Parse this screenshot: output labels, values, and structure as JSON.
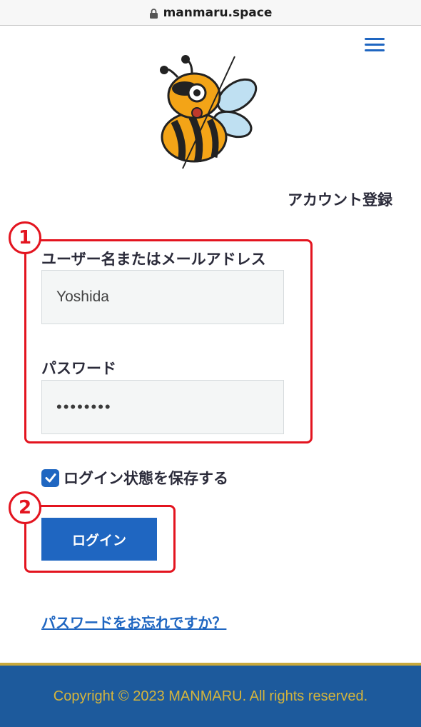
{
  "browser": {
    "url": "manmaru.space"
  },
  "header": {
    "menu_icon": "hamburger-icon"
  },
  "logo": {
    "icon": "bee-mascot-logo"
  },
  "nav": {
    "register_link": "アカウント登録"
  },
  "form": {
    "username_label": "ユーザー名またはメールアドレス",
    "username_value": "Yoshida",
    "password_label": "パスワード",
    "password_value": "••••••••",
    "remember_label": "ログイン状態を保存する",
    "remember_checked": true,
    "login_button": "ログイン",
    "forgot_link": "パスワードをお忘れですか？"
  },
  "annotations": {
    "step1": "1",
    "step2": "2",
    "color": "#e3141f"
  },
  "footer": {
    "copyright": "Copyright © 2023 MANMARU. All rights reserved."
  },
  "colors": {
    "accent": "#1f66c1",
    "footer_bg": "#1d5a9c",
    "footer_text": "#d4b43c"
  }
}
